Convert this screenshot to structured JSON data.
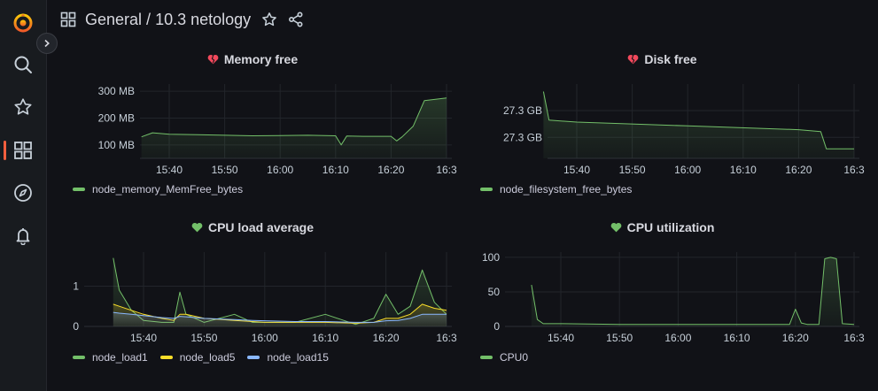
{
  "breadcrumb": {
    "folder": "General",
    "separator": " / ",
    "dashboard": "10.3 netology"
  },
  "sidebar": {
    "items": [
      "grafana-logo",
      "search",
      "starred",
      "dashboards",
      "explore",
      "alerting"
    ],
    "active": "dashboards"
  },
  "colors": {
    "green": "#73bf69",
    "yellow": "#fade2a",
    "blue": "#8ab8ff",
    "heart_broken": "#f2495c",
    "heart_ok": "#73bf69",
    "accent": "#f55f3e"
  },
  "panels": {
    "memory": {
      "title": "Memory free",
      "status_icon": "broken-heart-icon",
      "y_ticks": [
        "300 MB",
        "200 MB",
        "100 MB"
      ],
      "x_ticks": [
        "15:40",
        "15:50",
        "16:00",
        "16:10",
        "16:20",
        "16:3"
      ],
      "legend": [
        {
          "label": "node_memory_MemFree_bytes",
          "color": "#73bf69"
        }
      ]
    },
    "disk": {
      "title": "Disk free",
      "status_icon": "broken-heart-icon",
      "y_ticks": [
        "27.3 GB",
        "27.3 GB"
      ],
      "x_ticks": [
        "15:40",
        "15:50",
        "16:00",
        "16:10",
        "16:20",
        "16:3"
      ],
      "legend": [
        {
          "label": "node_filesystem_free_bytes",
          "color": "#73bf69"
        }
      ]
    },
    "cpu_load": {
      "title": "CPU load average",
      "status_icon": "heart-icon",
      "y_ticks": [
        "1",
        "0"
      ],
      "x_ticks": [
        "15:40",
        "15:50",
        "16:00",
        "16:10",
        "16:20",
        "16:3"
      ],
      "legend": [
        {
          "label": "node_load1",
          "color": "#73bf69"
        },
        {
          "label": "node_load5",
          "color": "#fade2a"
        },
        {
          "label": "node_load15",
          "color": "#8ab8ff"
        }
      ]
    },
    "cpu_util": {
      "title": "CPU utilization",
      "status_icon": "heart-icon",
      "y_ticks": [
        "100",
        "50",
        "0"
      ],
      "x_ticks": [
        "15:40",
        "15:50",
        "16:00",
        "16:10",
        "16:20",
        "16:3"
      ],
      "legend": [
        {
          "label": "CPU0",
          "color": "#73bf69"
        }
      ]
    }
  },
  "chart_data": [
    {
      "type": "line",
      "title": "Memory free",
      "y_unit": "MB",
      "ylim": [
        50,
        320
      ],
      "x": [
        "15:35",
        "15:37",
        "15:40",
        "15:45",
        "15:50",
        "15:55",
        "16:00",
        "16:05",
        "16:10",
        "16:11",
        "16:12",
        "16:15",
        "16:20",
        "16:21",
        "16:22",
        "16:24",
        "16:26",
        "16:28",
        "16:30"
      ],
      "series": [
        {
          "name": "node_memory_MemFree_bytes",
          "values": [
            130,
            145,
            140,
            138,
            136,
            134,
            135,
            136,
            134,
            100,
            133,
            132,
            132,
            115,
            130,
            170,
            265,
            270,
            275
          ]
        }
      ]
    },
    {
      "type": "line",
      "title": "Disk free",
      "y_unit": "GB",
      "x": [
        "15:34",
        "15:35",
        "15:40",
        "16:00",
        "16:20",
        "16:24",
        "16:25",
        "16:30"
      ],
      "series": [
        {
          "name": "node_filesystem_free_bytes",
          "values": [
            27.32,
            27.305,
            27.304,
            27.302,
            27.3,
            27.299,
            27.29,
            27.29
          ]
        }
      ]
    },
    {
      "type": "line",
      "title": "CPU load average",
      "ylim": [
        0,
        1.8
      ],
      "x": [
        "15:35",
        "15:36",
        "15:38",
        "15:40",
        "15:43",
        "15:45",
        "15:46",
        "15:47",
        "15:50",
        "15:55",
        "15:58",
        "16:00",
        "16:05",
        "16:10",
        "16:15",
        "16:18",
        "16:20",
        "16:22",
        "16:24",
        "16:26",
        "16:28",
        "16:30"
      ],
      "series": [
        {
          "name": "node_load1",
          "values": [
            1.7,
            0.9,
            0.4,
            0.15,
            0.1,
            0.1,
            0.85,
            0.3,
            0.1,
            0.3,
            0.1,
            0.1,
            0.1,
            0.3,
            0.05,
            0.2,
            0.8,
            0.3,
            0.5,
            1.4,
            0.6,
            0.3
          ]
        },
        {
          "name": "node_load5",
          "values": [
            0.55,
            0.5,
            0.4,
            0.3,
            0.2,
            0.15,
            0.3,
            0.3,
            0.2,
            0.15,
            0.12,
            0.1,
            0.1,
            0.1,
            0.08,
            0.1,
            0.2,
            0.2,
            0.3,
            0.55,
            0.45,
            0.4
          ]
        },
        {
          "name": "node_load15",
          "values": [
            0.35,
            0.33,
            0.3,
            0.27,
            0.22,
            0.2,
            0.25,
            0.24,
            0.2,
            0.17,
            0.15,
            0.14,
            0.12,
            0.12,
            0.1,
            0.1,
            0.14,
            0.15,
            0.2,
            0.3,
            0.3,
            0.3
          ]
        }
      ]
    },
    {
      "type": "line",
      "title": "CPU utilization",
      "ylim": [
        0,
        105
      ],
      "x": [
        "15:35",
        "15:36",
        "15:37",
        "15:40",
        "15:50",
        "16:00",
        "16:10",
        "16:19",
        "16:20",
        "16:21",
        "16:22",
        "16:24",
        "16:25",
        "16:26",
        "16:27",
        "16:28",
        "16:30"
      ],
      "series": [
        {
          "name": "CPU0",
          "values": [
            60,
            10,
            4,
            4,
            3,
            3,
            3,
            3,
            25,
            5,
            3,
            3,
            98,
            100,
            98,
            4,
            3
          ]
        }
      ]
    }
  ]
}
